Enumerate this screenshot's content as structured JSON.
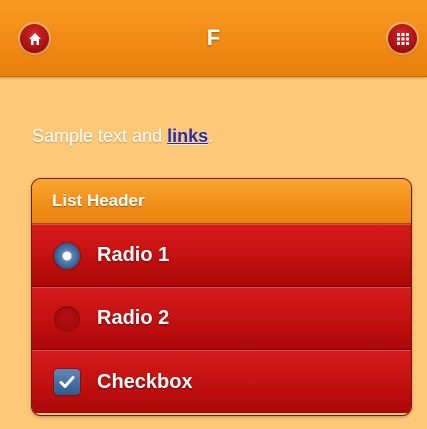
{
  "header": {
    "title": "F",
    "left_icon": "home-icon",
    "right_icon": "grid-icon"
  },
  "content": {
    "text_before": "Sample text and ",
    "link_text": "links",
    "text_after": "."
  },
  "list": {
    "header": "List Header",
    "items": [
      {
        "label": "Radio 1",
        "type": "radio",
        "checked": true
      },
      {
        "label": "Radio 2",
        "type": "radio",
        "checked": false
      },
      {
        "label": "Checkbox",
        "type": "checkbox",
        "checked": true
      }
    ]
  },
  "colors": {
    "header_bar": "#f08b15",
    "page_background": "#fdc878",
    "list_row": "#c41111",
    "control_accent": "#2d5a8e",
    "link": "#2a2aa8"
  }
}
